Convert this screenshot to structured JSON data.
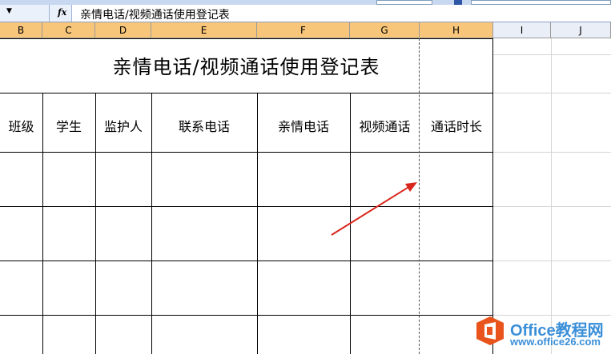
{
  "formula_bar": {
    "fx_label": "fx",
    "content": "亲情电话/视频通话使用登记表"
  },
  "columns": [
    "B",
    "C",
    "D",
    "E",
    "F",
    "G",
    "H",
    "I",
    "J"
  ],
  "sheet": {
    "title": "亲情电话/视频通话使用登记表",
    "headers": [
      "班级",
      "学生",
      "监护人",
      "联系电话",
      "亲情电话",
      "视频通话",
      "通话时长"
    ]
  },
  "watermark": {
    "brand": "Office教程网",
    "url": "www.office26.com"
  },
  "colors": {
    "selected_header": "#f8c67a",
    "arrow": "#d9261c",
    "watermark_orange": "#e8541c",
    "watermark_blue": "#3a8fd8"
  }
}
